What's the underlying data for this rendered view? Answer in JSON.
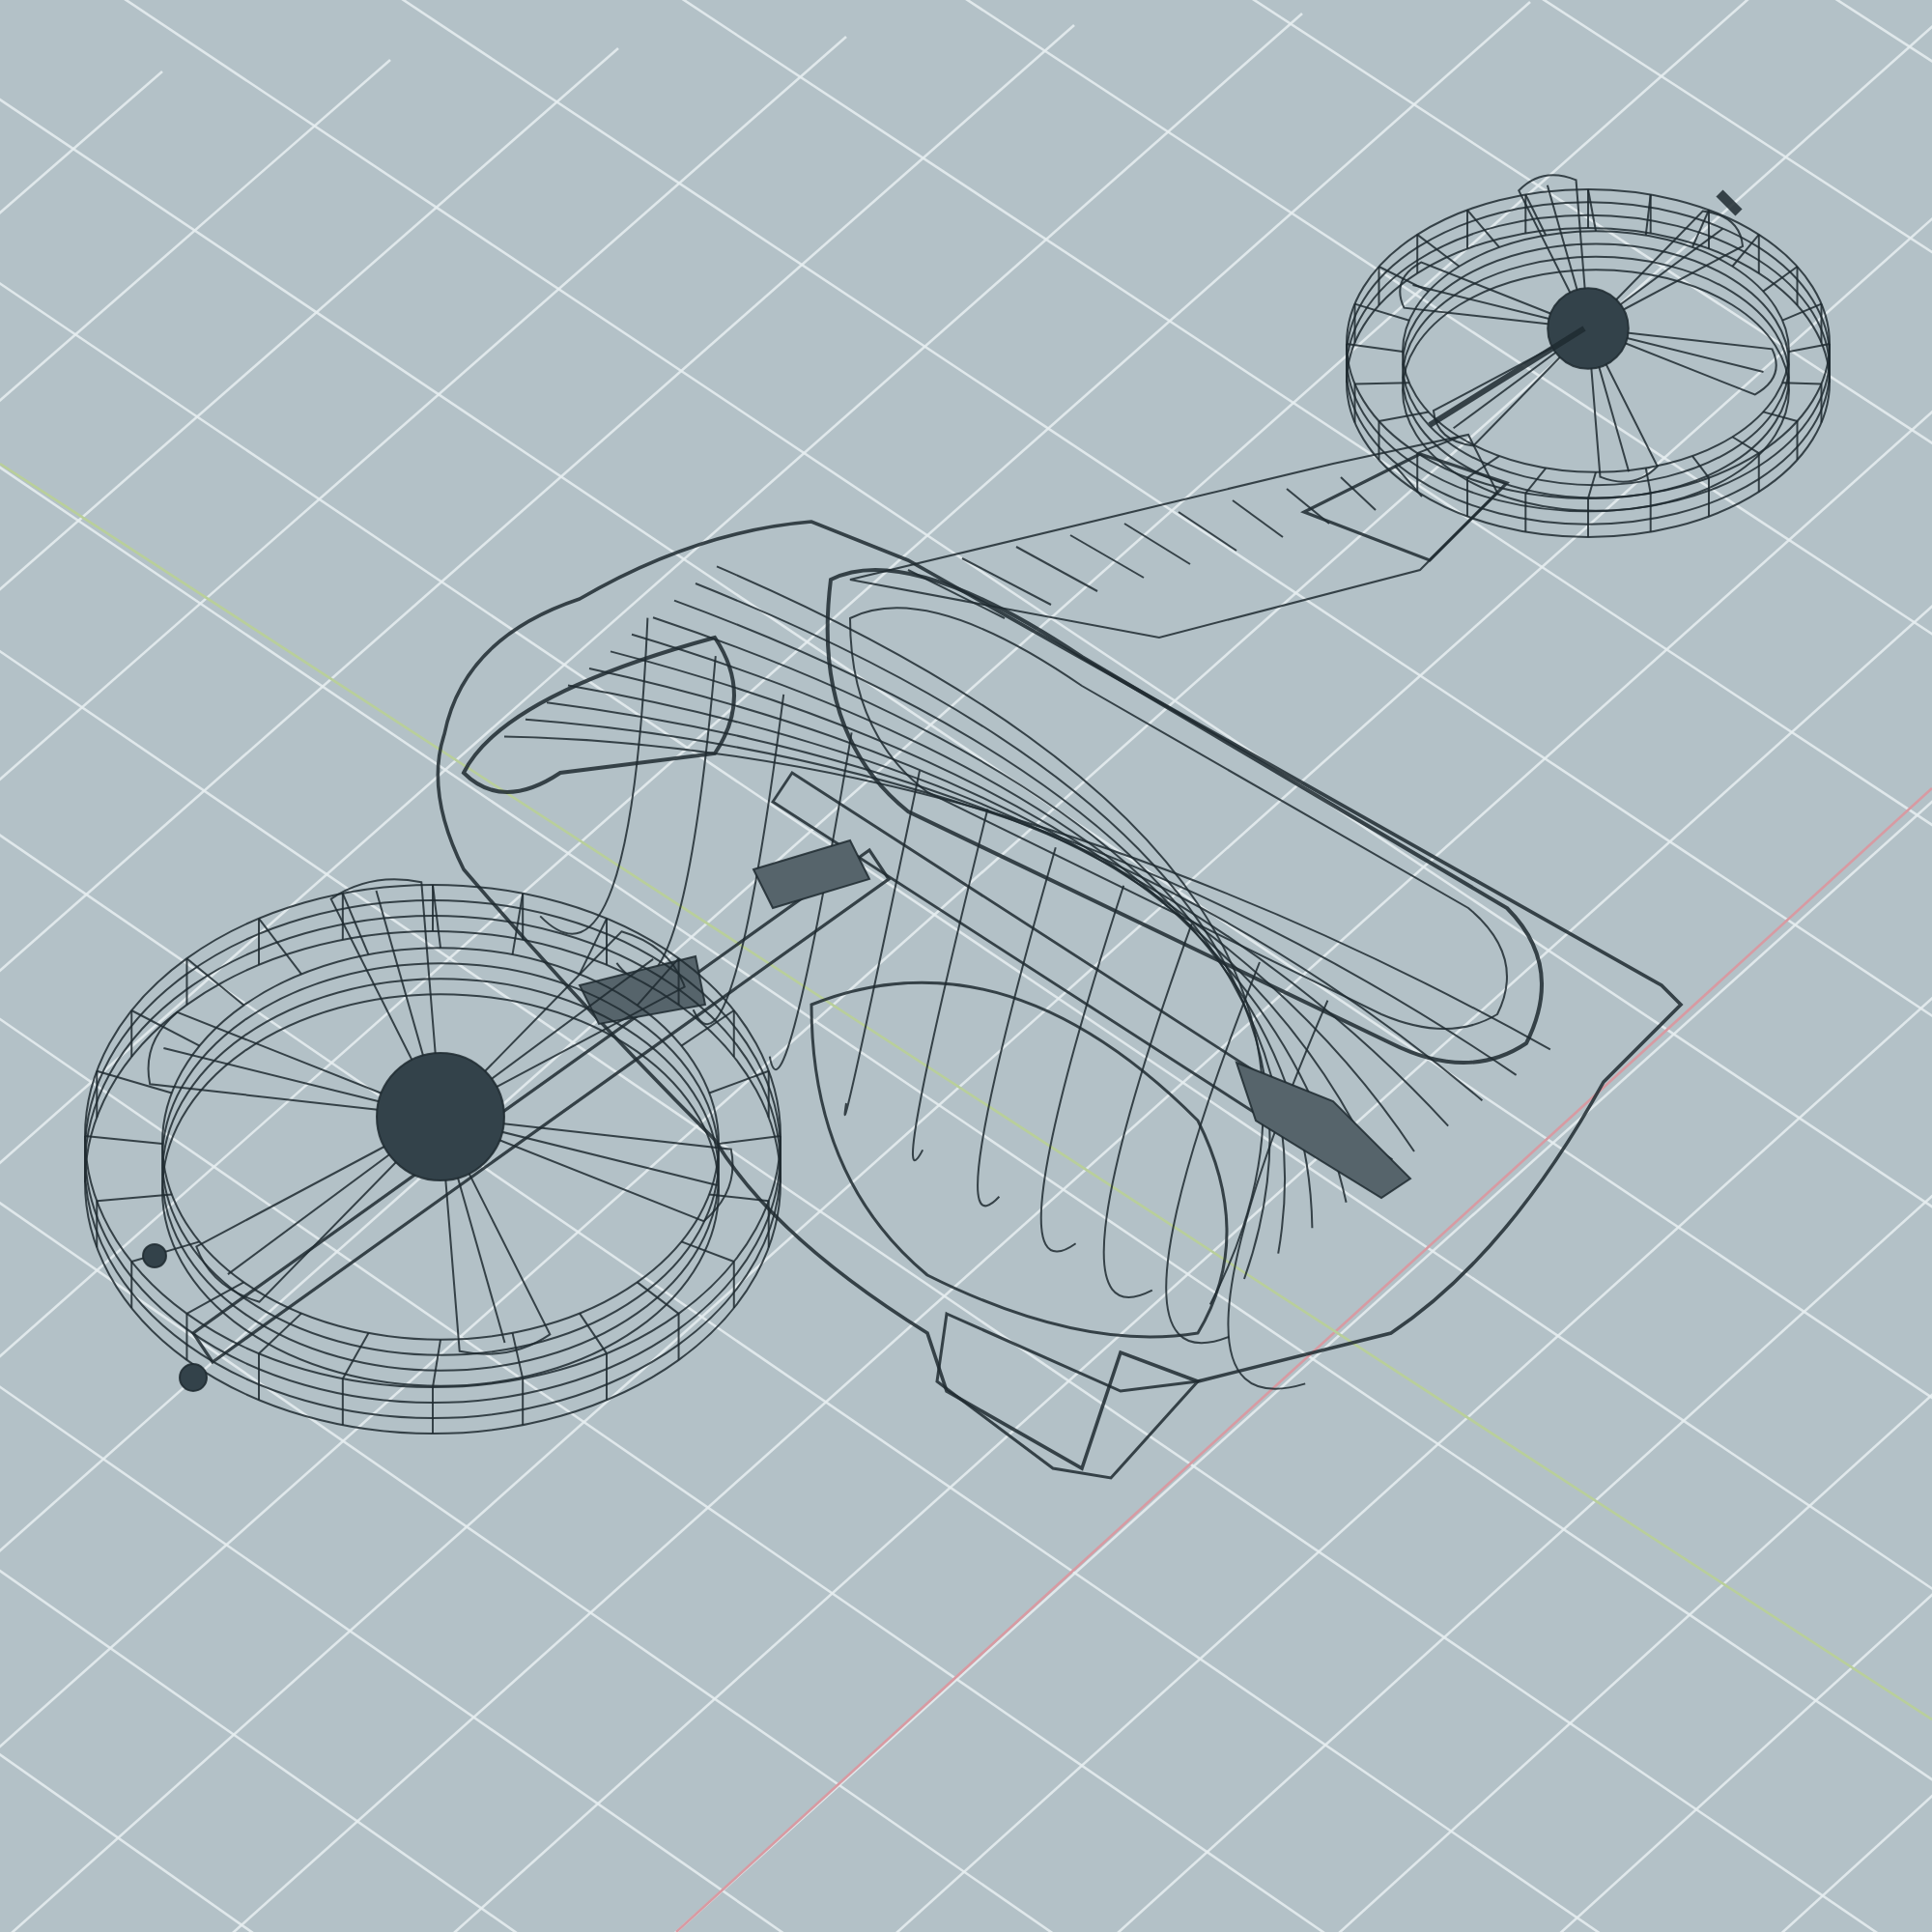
{
  "viewport": {
    "grid_visible": true,
    "axes_visible": true,
    "wireframe": true
  }
}
